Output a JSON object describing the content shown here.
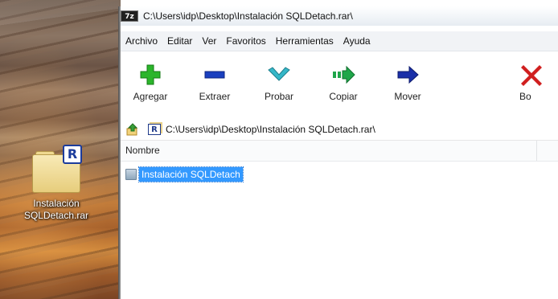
{
  "desktop": {
    "icon_label_line1": "Instalación",
    "icon_label_line2": "SQLDetach.rar",
    "icon_badge": "R"
  },
  "window": {
    "app_icon_text": "7z",
    "title": "C:\\Users\\idp\\Desktop\\Instalación SQLDetach.rar\\"
  },
  "menu": {
    "items": [
      "Archivo",
      "Editar",
      "Ver",
      "Favoritos",
      "Herramientas",
      "Ayuda"
    ]
  },
  "toolbar": {
    "buttons": [
      {
        "label": "Agregar",
        "icon": "plus-icon",
        "color": "#2bb52b"
      },
      {
        "label": "Extraer",
        "icon": "minus-icon",
        "color": "#1a3fbf"
      },
      {
        "label": "Probar",
        "icon": "checkmark-icon",
        "color": "#35b7c8"
      },
      {
        "label": "Copiar",
        "icon": "copy-arrow-icon",
        "color": "#1fa64a"
      },
      {
        "label": "Mover",
        "icon": "move-arrow-icon",
        "color": "#1a2fa8"
      },
      {
        "label": "Bo",
        "icon": "delete-x-icon",
        "color": "#d01f1f"
      }
    ]
  },
  "address": {
    "icon_badge": "R",
    "path": "C:\\Users\\idp\\Desktop\\Instalación SQLDetach.rar\\"
  },
  "list": {
    "column_name": "Nombre",
    "rows": [
      {
        "name": "Instalación SQLDetach",
        "selected": true
      }
    ]
  }
}
